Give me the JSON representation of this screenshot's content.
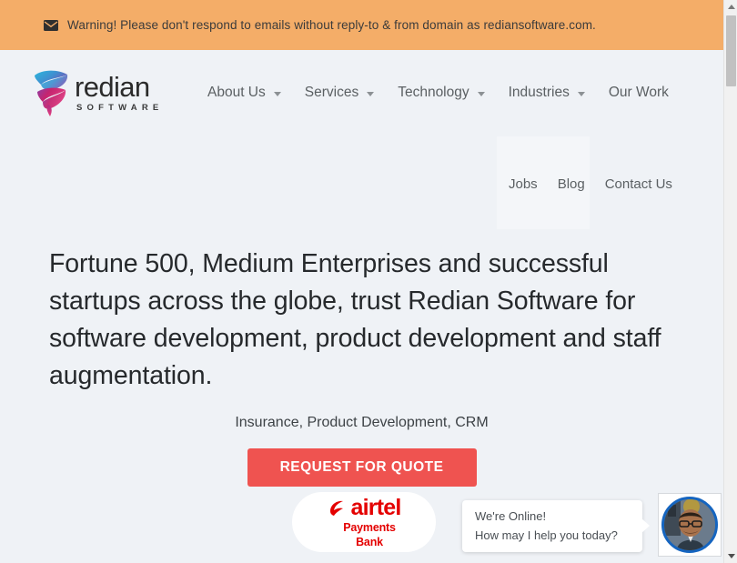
{
  "banner": {
    "icon": "envelope-icon",
    "text": "Warning! Please don't respond to emails without reply-to & from domain as rediansoftware.com.",
    "background_color": "#f4ad68"
  },
  "header": {
    "logo": {
      "word": "redian",
      "subtitle": "SOFTWARE",
      "mark_gradient_start": "#29b6d8",
      "mark_gradient_end": "#d6246e"
    },
    "primary_nav": [
      {
        "label": "About Us",
        "has_dropdown": true,
        "caret_icon": "chevron-down-icon"
      },
      {
        "label": "Services",
        "has_dropdown": true,
        "caret_icon": "chevron-down-icon"
      },
      {
        "label": "Technology",
        "has_dropdown": true,
        "caret_icon": "chevron-down-icon"
      },
      {
        "label": "Industries",
        "has_dropdown": true,
        "caret_icon": "chevron-down-icon"
      },
      {
        "label": "Our Work",
        "has_dropdown": false
      }
    ],
    "secondary_nav": [
      {
        "label": "Jobs"
      },
      {
        "label": "Blog"
      },
      {
        "label": "Contact Us"
      }
    ]
  },
  "hero": {
    "headline": "Fortune 500, Medium Enterprises and successful startups across the globe, trust Redian Software for software development, product development and staff augmentation.",
    "subtitle": "Insurance, Product Development, CRM",
    "cta_label": "REQUEST FOR QUOTE",
    "cta_color": "#ef5350"
  },
  "client_logo": {
    "name": "airtel",
    "line2": "Payments",
    "line3": "Bank",
    "color": "#e40000"
  },
  "chat_widget": {
    "greeting": "We're Online!",
    "prompt": "How may I help you today?",
    "avatar_ring_color": "#1565c0"
  },
  "scrollbar": {
    "up_arrow_icon": "scroll-up-arrow-icon",
    "down_arrow_icon": "scroll-down-arrow-icon"
  }
}
